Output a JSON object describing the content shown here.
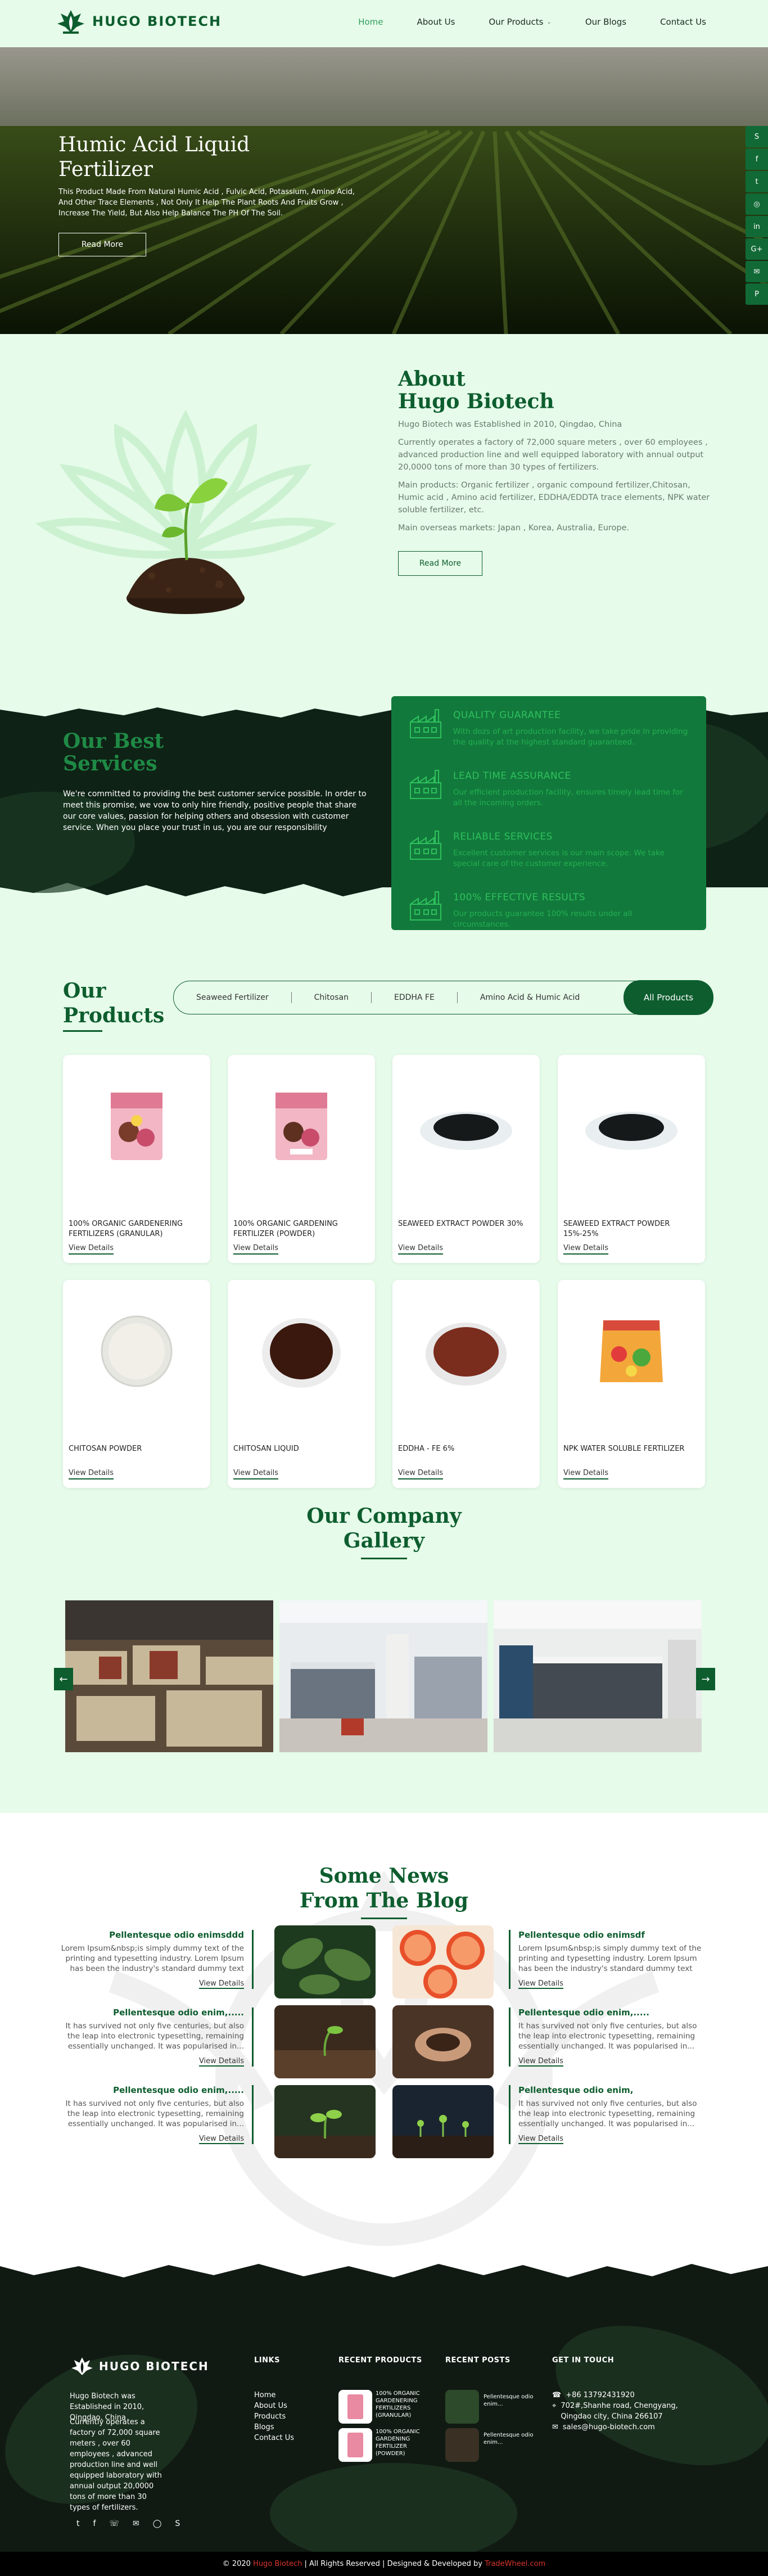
{
  "brand": {
    "name": "HUGO BIOTECH",
    "accent": "#0d5d2e",
    "bg": "#e6fbe9"
  },
  "nav": {
    "items": [
      "Home",
      "About Us",
      "Our Products",
      "Our Blogs",
      "Contact Us"
    ]
  },
  "hero": {
    "title": "Humic Acid Liquid Fertilizer",
    "text": "This Product Made From Natural Humic Acid , Fulvic Acid, Potassium, Amino Acid, And Other Trace Elements , Not Only It Help The Plant Roots And Fruits Grow , Increase The Yield, But Also Help Balance The PH Of The Soil.",
    "button": "Read More"
  },
  "social": [
    "skype-icon",
    "facebook-icon",
    "twitter-icon",
    "instagram-icon",
    "linkedin-icon",
    "google-plus-icon",
    "wechat-icon",
    "pinterest-icon"
  ],
  "about": {
    "heading1": "About",
    "heading2": "Hugo Biotech",
    "p1": "Hugo Biotech was Established in 2010, Qingdao, China",
    "p2": "Currently operates a factory of 72,000 square meters , over 60 employees , advanced production line and well equipped laboratory with annual output 20,0000 tons of more than 30 types of fertilizers.",
    "p3": "Main products:  Organic fertilizer , organic compound fertilizer,Chitosan, Humic acid , Amino acid fertilizer, EDDHA/EDDTA trace elements,  NPK water soluble fertilizer, etc.",
    "p4": "Main overseas markets:  Japan , Korea, Australia, Europe.",
    "button": "Read More"
  },
  "services": {
    "heading1": "Our Best",
    "heading2": "Services",
    "text": "We're committed to providing the best customer service possible. In order to meet this promise, we vow to only hire friendly, positive people that share our core values, passion for helping others and obsession with customer service. When you place your trust in us, you are our responsibility",
    "items": [
      {
        "title": "QUALITY GUARANTEE",
        "desc": "With dozs of art production facility, we take pride in providing the quality at the highest standard guaranteed.",
        "icon": "factory-icon"
      },
      {
        "title": "LEAD TIME ASSURANCE",
        "desc": "Our efficient production facility, ensures timely lead time for all the incoming orders.",
        "icon": "factory-icon"
      },
      {
        "title": "RELIABLE SERVICES",
        "desc": "Excellent customer services is our main scope. We take special care of the customer experience.",
        "icon": "factory-icon"
      },
      {
        "title": "100% EFFECTIVE RESULTS",
        "desc": "Our products guarantee 100% results under all circumstances.",
        "icon": "factory-icon"
      }
    ]
  },
  "products": {
    "heading1": "Our",
    "heading2": "Products",
    "tabs": [
      "Seaweed Fertilizer",
      "Chitosan",
      "EDDHA FE",
      "Amino Acid & Humic Acid"
    ],
    "all_tab": "All Products",
    "view_label": "View Details",
    "items": [
      {
        "name": "100% ORGANIC GARDENERING FERTILIZERS (GRANULAR)",
        "kind": "bag"
      },
      {
        "name": "100% ORGANIC GARDENING FERTILIZER (POWDER)",
        "kind": "bag"
      },
      {
        "name": "SEAWEED EXTRACT POWDER 30%",
        "kind": "black-dish"
      },
      {
        "name": "SEAWEED EXTRACT POWDER 15%-25%",
        "kind": "black-dish"
      },
      {
        "name": "CHITOSAN POWDER",
        "kind": "white-dish"
      },
      {
        "name": "CHITOSAN LIQUID",
        "kind": "brown-dish"
      },
      {
        "name": "EDDHA - FE 6%",
        "kind": "red-dish"
      },
      {
        "name": "NPK WATER SOLUBLE FERTILIZER",
        "kind": "pouch"
      }
    ]
  },
  "gallery": {
    "heading1": "Our Company",
    "heading2": "Gallery",
    "prev": "←",
    "next": "→"
  },
  "blog": {
    "heading1": "Some News",
    "heading2": "From The Blog",
    "view_label": "View Details",
    "posts": [
      {
        "title": "Pellentesque odio enimsddd",
        "desc": "Lorem Ipsum&nbsp;is simply dummy text of the printing and typesetting industry. Lorem Ipsum has been the industry's standard dummy text"
      },
      {
        "title": "Pellentesque odio enimsdf",
        "desc": "Lorem Ipsum&nbsp;is simply dummy text of the printing and typesetting industry. Lorem Ipsum has been the industry's standard dummy text"
      },
      {
        "title": "Pellentesque odio enim,.....",
        "desc": "It has survived not only five centuries, but also the leap into electronic typesetting, remaining essentially unchanged. It was popularised in..."
      },
      {
        "title": "Pellentesque odio enim,.....",
        "desc": "It has survived not only five centuries, but also the leap into electronic typesetting, remaining essentially unchanged. It was popularised in..."
      },
      {
        "title": "Pellentesque odio enim,.....",
        "desc": "It has survived not only five centuries, but also the leap into electronic typesetting, remaining essentially unchanged. It was popularised in..."
      },
      {
        "title": "Pellentesque odio enim,",
        "desc": "It has survived not only five centuries, but also the leap into electronic typesetting, remaining essentially unchanged. It was popularised in..."
      }
    ]
  },
  "footer": {
    "about1": "Hugo Biotech was Established in 2010, Qingdao, China",
    "about2": "Currently operates a factory of 72,000 square meters , over 60 employees , advanced production line and well equipped laboratory with annual output 20,0000 tons of more than 30 types of fertilizers.",
    "links_heading": "LINKS",
    "links": [
      "Home",
      "About Us",
      "Products",
      "Blogs",
      "Contact Us"
    ],
    "recent_products_heading": "RECENT PRODUCTS",
    "recent_products": [
      "100% ORGANIC GARDENERING FERTILIZERS (GRANULAR)",
      "100% ORGANIC GARDENING FERTILIZER (POWDER)"
    ],
    "recent_posts_heading": "RECENT POSTS",
    "recent_posts": [
      "Pellentesque odio enim...",
      "Pellentesque odio enim..."
    ],
    "contact_heading": "GET IN TOUCH",
    "phone": "+86 13792431920",
    "address": "702#,Shanhe road, Chengyang, Qingdao city, China 266107",
    "email": "sales@hugo-biotech.com",
    "social": [
      "twitter-icon",
      "facebook-icon",
      "phone-icon",
      "wechat-icon",
      "whatsapp-icon",
      "skype-icon"
    ],
    "copyright_pre": "© 2020",
    "copyright_brand": "Hugo Biotech",
    "copyright_mid": "| All Rights Reserved | Designed & Developed by",
    "copyright_dev": "TradeWheel.com"
  }
}
